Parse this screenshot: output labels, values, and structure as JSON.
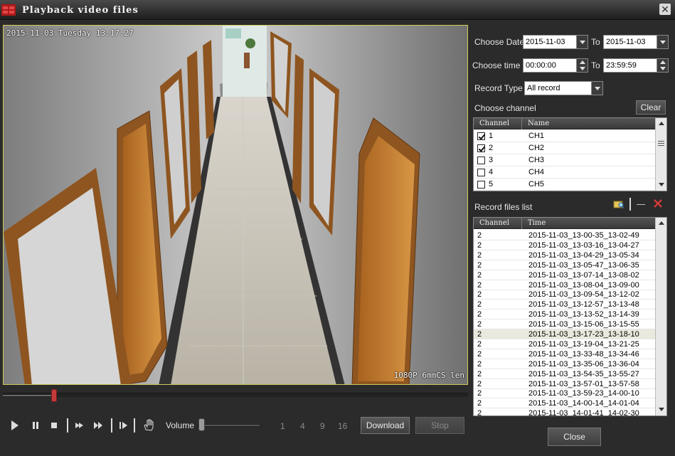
{
  "window": {
    "title": "Playback video files"
  },
  "video": {
    "timestamp_osd": "2015-11-03 Tuesday 13:17:27",
    "lens_osd": "1080P 6mmCS len"
  },
  "playback": {
    "progress": 0.11,
    "volume": 0.0
  },
  "controls": {
    "volume_label": "Volume",
    "split_options": [
      "1",
      "4",
      "9",
      "16"
    ],
    "download_label": "Download",
    "stop_label": "Stop"
  },
  "filters": {
    "date_label": "Choose Date",
    "date_from": "2015-11-03",
    "to_label": "To",
    "date_to": "2015-11-03",
    "time_label": "Choose time",
    "time_from": "00:00:00",
    "time_to": "23:59:59",
    "record_type_label": "Record Type",
    "record_type": "All record"
  },
  "channels": {
    "label": "Choose channel",
    "clear_label": "Clear",
    "headers": [
      "Channel",
      "Name"
    ],
    "rows": [
      {
        "channel": "1",
        "name": "CH1",
        "checked": true
      },
      {
        "channel": "2",
        "name": "CH2",
        "checked": true
      },
      {
        "channel": "3",
        "name": "CH3",
        "checked": false
      },
      {
        "channel": "4",
        "name": "CH4",
        "checked": false
      },
      {
        "channel": "5",
        "name": "CH5",
        "checked": false
      }
    ]
  },
  "records": {
    "label": "Record files list",
    "headers": [
      "Channel",
      "Time"
    ],
    "selected_index": 10,
    "rows": [
      {
        "channel": "2",
        "time": "2015-11-03_13-00-35_13-02-49"
      },
      {
        "channel": "2",
        "time": "2015-11-03_13-03-16_13-04-27"
      },
      {
        "channel": "2",
        "time": "2015-11-03_13-04-29_13-05-34"
      },
      {
        "channel": "2",
        "time": "2015-11-03_13-05-47_13-06-35"
      },
      {
        "channel": "2",
        "time": "2015-11-03_13-07-14_13-08-02"
      },
      {
        "channel": "2",
        "time": "2015-11-03_13-08-04_13-09-00"
      },
      {
        "channel": "2",
        "time": "2015-11-03_13-09-54_13-12-02"
      },
      {
        "channel": "2",
        "time": "2015-11-03_13-12-57_13-13-48"
      },
      {
        "channel": "2",
        "time": "2015-11-03_13-13-52_13-14-39"
      },
      {
        "channel": "2",
        "time": "2015-11-03_13-15-06_13-15-55"
      },
      {
        "channel": "2",
        "time": "2015-11-03_13-17-23_13-18-10"
      },
      {
        "channel": "2",
        "time": "2015-11-03_13-19-04_13-21-25"
      },
      {
        "channel": "2",
        "time": "2015-11-03_13-33-48_13-34-46"
      },
      {
        "channel": "2",
        "time": "2015-11-03_13-35-06_13-36-04"
      },
      {
        "channel": "2",
        "time": "2015-11-03_13-54-35_13-55-27"
      },
      {
        "channel": "2",
        "time": "2015-11-03_13-57-01_13-57-58"
      },
      {
        "channel": "2",
        "time": "2015-11-03_13-59-23_14-00-10"
      },
      {
        "channel": "2",
        "time": "2015-11-03_14-00-14_14-01-04"
      },
      {
        "channel": "2",
        "time": "2015-11-03_14-01-41_14-02-30"
      }
    ]
  },
  "footer": {
    "close_label": "Close"
  },
  "icons": {
    "logo": "app-logo-icon",
    "close": "close-icon",
    "play": "play-icon",
    "pause": "pause-icon",
    "stop": "stop-icon",
    "step": "step-forward-icon",
    "fast": "fast-forward-icon",
    "frame": "frame-advance-icon",
    "hand": "hand-icon",
    "search_folder": "search-folder-icon",
    "minus": "minus-icon",
    "delete": "delete-icon"
  },
  "colors": {
    "video_border": "#cfc95a",
    "progress_thumb": "#c23a3a",
    "delete": "#d43a3a"
  }
}
